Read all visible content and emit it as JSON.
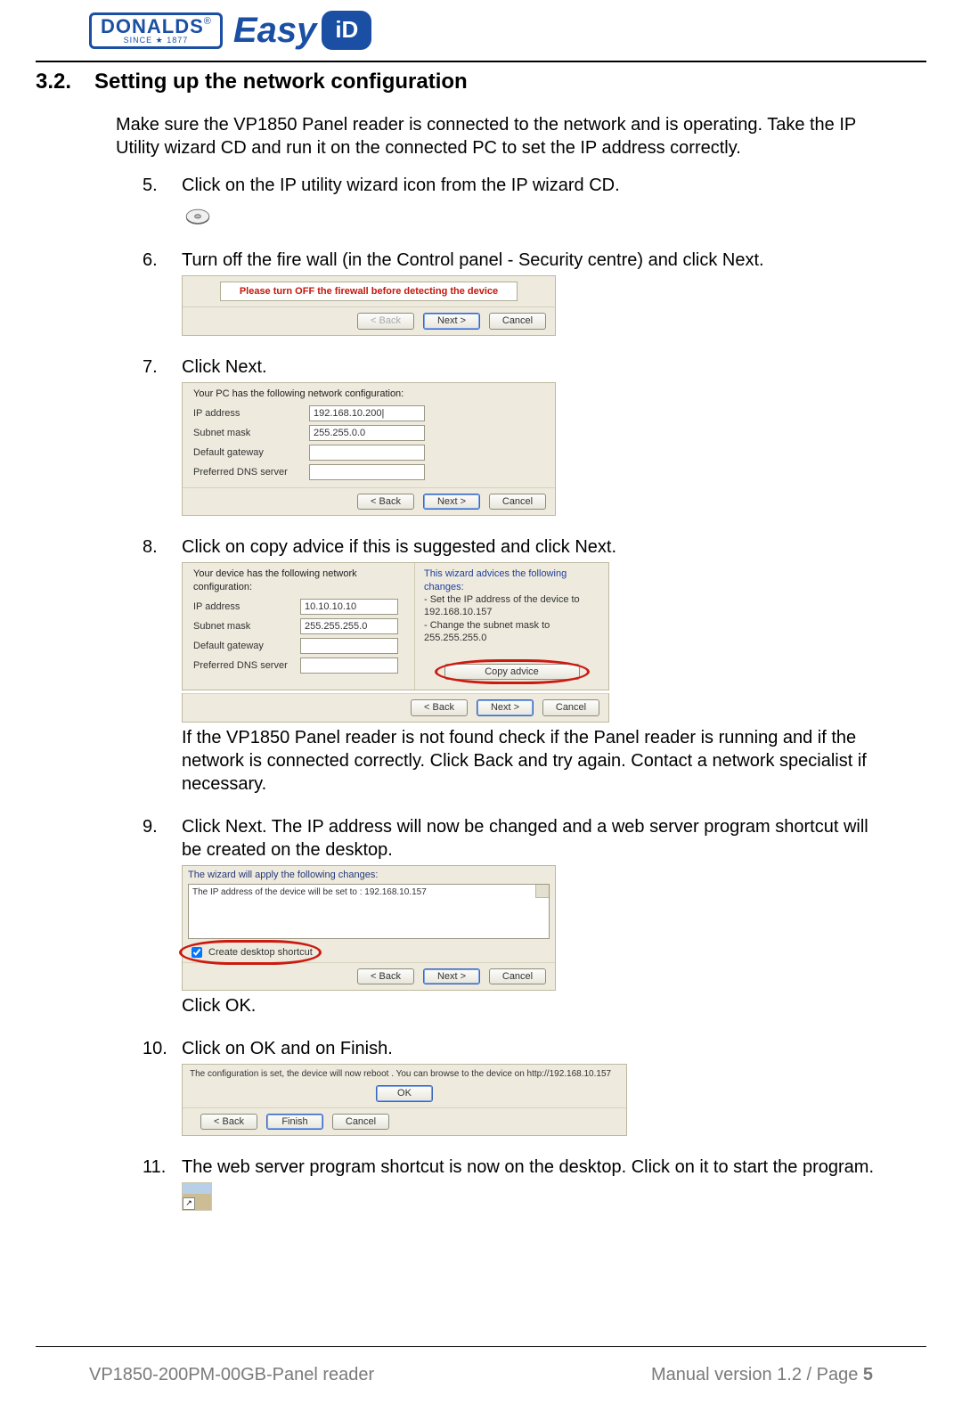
{
  "header": {
    "donalds_brand": "DONALDS",
    "donalds_reg": "®",
    "donalds_since": "SINCE ★ 1877",
    "easy": "Easy",
    "id": "iD"
  },
  "section": {
    "number": "3.2.",
    "title": "Setting up the network configuration",
    "intro": "Make sure the VP1850 Panel reader is connected to the network and is operating. Take the IP Utility wizard CD and run it on the connected PC to set the IP address correctly."
  },
  "buttons": {
    "back": "< Back",
    "next": "Next >",
    "cancel": "Cancel",
    "finish": "Finish",
    "ok": "OK"
  },
  "steps": {
    "s5": {
      "no": "5.",
      "text": "Click on the IP utility wizard icon from the IP wizard CD."
    },
    "s6": {
      "no": "6.",
      "text": "Turn off the fire wall (in the Control panel - Security centre) and click Next.",
      "warning": "Please turn OFF the firewall before detecting the device"
    },
    "s7": {
      "no": "7.",
      "text": "Click Next.",
      "caption": "Your PC has the following network configuration:",
      "fields": {
        "ip_label": "IP address",
        "ip_value": "192.168.10.200|",
        "mask_label": "Subnet mask",
        "mask_value": "255.255.0.0",
        "gw_label": "Default gateway",
        "gw_value": "",
        "dns_label": "Preferred DNS server",
        "dns_value": ""
      }
    },
    "s8": {
      "no": "8.",
      "text": "Click on copy advice if this is suggested and click Next.",
      "caption_left": "Your device has the following network configuration:",
      "fields": {
        "ip_label": "IP address",
        "ip_value": "10.10.10.10",
        "mask_label": "Subnet mask",
        "mask_value": "255.255.255.0",
        "gw_label": "Default gateway",
        "gw_value": "",
        "dns_label": "Preferred DNS server",
        "dns_value": ""
      },
      "advice_title": "This wizard advices the following changes:",
      "advice1": "- Set the IP address of the device to 192.168.10.157",
      "advice2": "- Change the subnet mask to 255.255.255.0",
      "copy_btn": "Copy advice",
      "after": "If the VP1850 Panel reader is not found check if the Panel reader is running and if the network is connected correctly. Click Back and try again. Contact a network specialist if necessary."
    },
    "s9": {
      "no": "9.",
      "text": "Click Next. The IP address will now be changed and a web server program shortcut will be created on the desktop.",
      "title": "The wizard will apply the following changes:",
      "line": "The IP address of the device will be set to : 192.168.10.157",
      "checkbox": "Create desktop shortcut",
      "after": "Click OK."
    },
    "s10": {
      "no": "10.",
      "text": "Click on OK and on Finish.",
      "msg": "The configuration is set, the device will now reboot . You can browse to the device on http://192.168.10.157"
    },
    "s11": {
      "no": "11.",
      "text": "The web server program shortcut is now on the desktop. Click on it to start the program."
    }
  },
  "footer": {
    "left": "VP1850-200PM-00GB-Panel reader",
    "right_a": "Manual version 1.2 / Page ",
    "right_b": "5"
  }
}
